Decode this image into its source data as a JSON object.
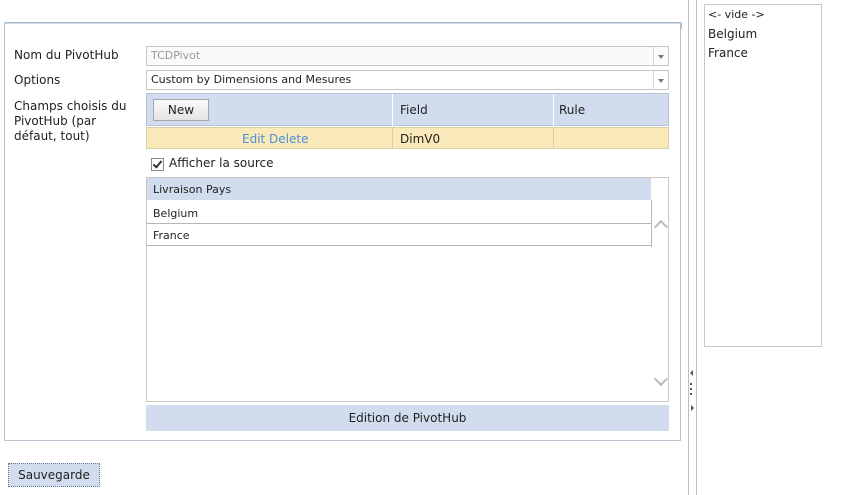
{
  "form": {
    "name_label": "Nom du PivotHub",
    "name_value": "TCDPivot",
    "options_label": "Options",
    "options_value": "Custom by Dimensions and Mesures",
    "fields_label": "Champs choisis du PivotHub (par défaut, tout)"
  },
  "grid": {
    "new_label": "New",
    "columns": [
      "Field",
      "Rule"
    ],
    "rows": [
      {
        "actions": "Edit Delete",
        "field": "DimV0",
        "rule": ""
      }
    ]
  },
  "source": {
    "checkbox_label": "Afficher la source",
    "checked": true,
    "header": "Livraison Pays",
    "rows": [
      "Belgium",
      "France"
    ]
  },
  "edition_label": "Edition de PivotHub",
  "save_label": "Sauvegarde",
  "right_list": [
    "<- vide ->",
    "Belgium",
    "France"
  ],
  "colors": {
    "header_blue": "#d1dcee",
    "selected_row": "#fbeab9",
    "link_blue": "#4a8fd6"
  }
}
